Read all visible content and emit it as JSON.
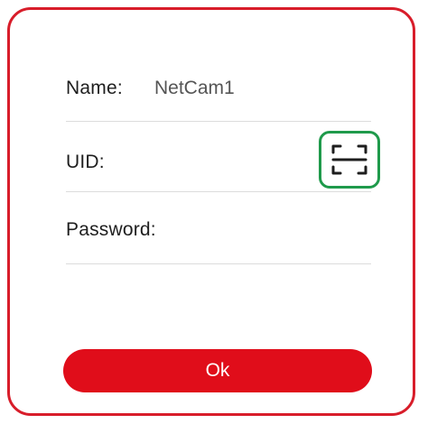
{
  "form": {
    "name_label": "Name:",
    "name_value": "NetCam1",
    "uid_label": "UID:",
    "password_label": "Password:"
  },
  "actions": {
    "ok_label": "Ok"
  },
  "icons": {
    "scan": "qr-scan-icon"
  },
  "colors": {
    "border": "#d81d2a",
    "button": "#e00d1a",
    "scan_highlight": "#1f9a4b"
  }
}
